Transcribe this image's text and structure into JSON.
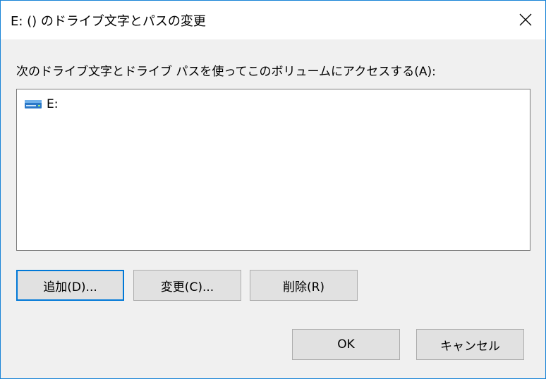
{
  "window": {
    "title": "E: () のドライブ文字とパスの変更",
    "close_icon": "close-icon"
  },
  "prompt": {
    "label": "次のドライブ文字とドライブ パスを使ってこのボリュームにアクセスする(A):"
  },
  "list": {
    "items": [
      {
        "icon": "drive-icon",
        "label": "E:"
      }
    ]
  },
  "buttons": {
    "add": "追加(D)...",
    "change": "変更(C)...",
    "remove": "削除(R)",
    "ok": "OK",
    "cancel": "キャンセル"
  },
  "colors": {
    "accent": "#0078d7",
    "drive_icon": "#2a78c8"
  }
}
